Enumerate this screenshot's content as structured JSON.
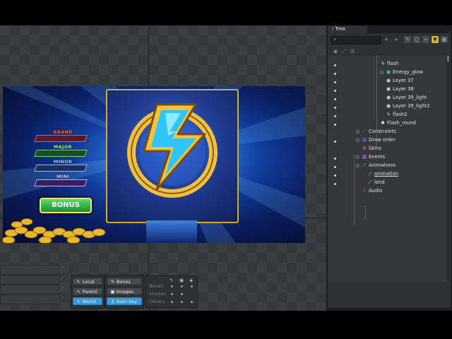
{
  "viewport": {
    "jackpots": {
      "grand": "GRAND",
      "major": "MAJOR",
      "minor": "MINOR",
      "mini": "MINI"
    },
    "bonus_label": "BONUS"
  },
  "toolbar": {
    "transform": {
      "local": "Local",
      "parent": "Parent",
      "world": "World"
    },
    "mode": {
      "bones": "Bones",
      "images": "Images",
      "auto_key": "Auto Key"
    },
    "visibility": {
      "bones": "Bones",
      "images": "Images",
      "others": "Others"
    }
  },
  "tree": {
    "tab_label": "Tree",
    "search_placeholder": "",
    "nodes": [
      {
        "label": "flash",
        "icon": "lightning-icon"
      },
      {
        "label": "Energy_glow",
        "icon": "slot-icon"
      },
      {
        "label": "Layer 37",
        "icon": "slot-icon"
      },
      {
        "label": "Layer 38",
        "icon": "slot-icon"
      },
      {
        "label": "Layer 39_light",
        "icon": "slot-icon"
      },
      {
        "label": "Layer 39_light2",
        "icon": "slot-icon"
      },
      {
        "label": "flash2",
        "icon": "lightning-icon"
      },
      {
        "label": "Flash_round",
        "icon": "clover-icon"
      },
      {
        "label": "Constraints",
        "icon": "constraint-icon"
      },
      {
        "label": "Draw order",
        "icon": "draw-order-icon"
      },
      {
        "label": "Skins",
        "icon": "skin-icon"
      },
      {
        "label": "Events",
        "icon": "event-icon"
      },
      {
        "label": "Animations",
        "icon": "animation-icon"
      },
      {
        "label": "animation",
        "icon": "animation-icon"
      },
      {
        "label": "land",
        "icon": "animation-icon"
      },
      {
        "label": "Audio",
        "icon": "audio-icon"
      }
    ]
  },
  "colors": {
    "accent": "#3b9bd8",
    "selected_tool": "#d8b533",
    "panel": "#2e3033"
  }
}
